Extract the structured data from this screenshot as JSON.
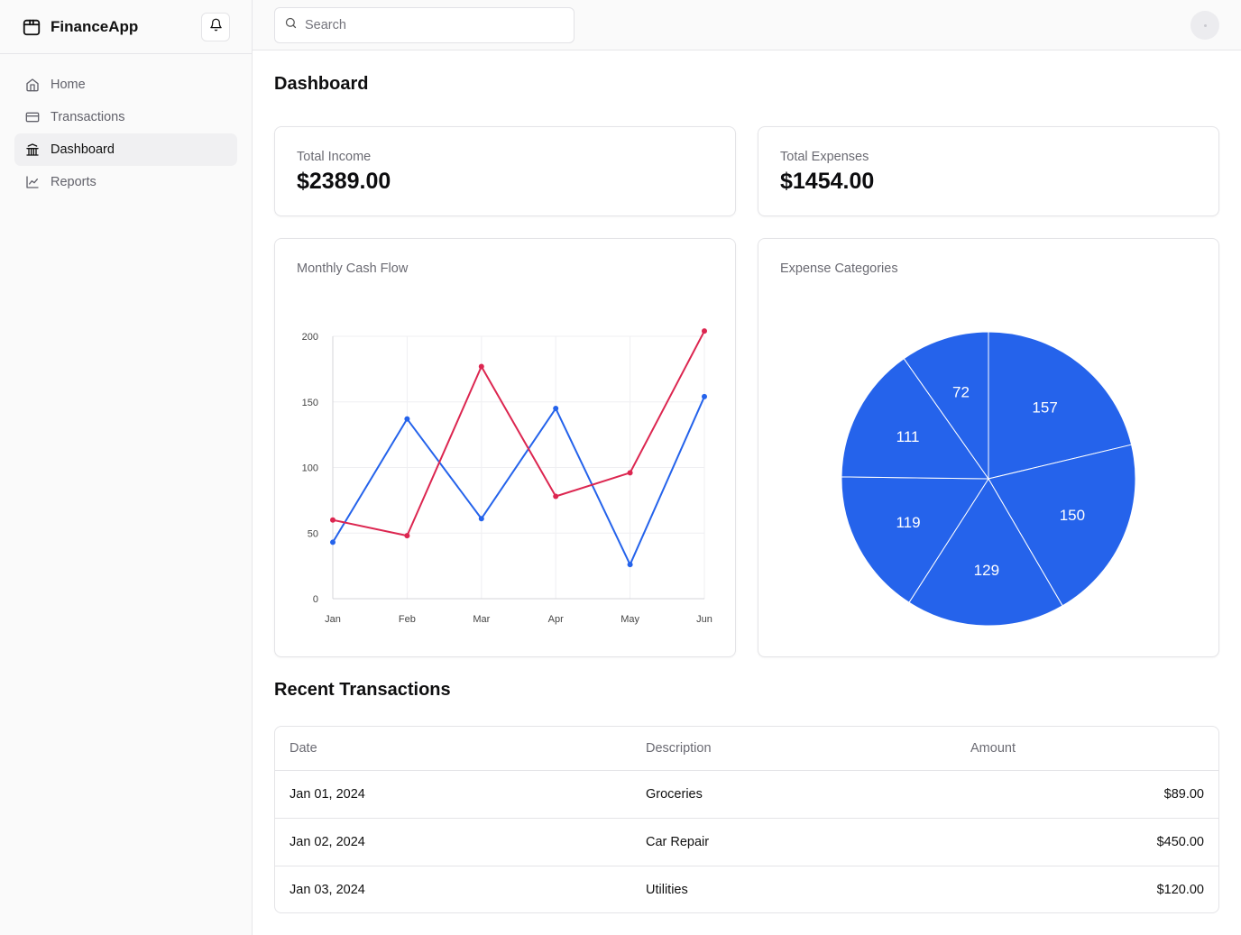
{
  "app": {
    "name": "FinanceApp"
  },
  "sidebar": {
    "items": [
      {
        "label": "Home",
        "icon": "home-icon",
        "active": false
      },
      {
        "label": "Transactions",
        "icon": "credit-card-icon",
        "active": false
      },
      {
        "label": "Dashboard",
        "icon": "bank-icon",
        "active": true
      },
      {
        "label": "Reports",
        "icon": "line-chart-icon",
        "active": false
      }
    ]
  },
  "topbar": {
    "search_placeholder": "Search"
  },
  "page": {
    "title": "Dashboard"
  },
  "stats": {
    "income": {
      "label": "Total Income",
      "value": "$2389.00"
    },
    "expenses": {
      "label": "Total Expenses",
      "value": "$1454.00"
    }
  },
  "cashflow": {
    "title": "Monthly Cash Flow"
  },
  "expense_categories": {
    "title": "Expense Categories"
  },
  "chart_data": [
    {
      "type": "line",
      "title": "Monthly Cash Flow",
      "categories": [
        "Jan",
        "Feb",
        "Mar",
        "Apr",
        "May",
        "Jun"
      ],
      "ylim": [
        0,
        200
      ],
      "yticks": [
        0,
        50,
        100,
        150,
        200
      ],
      "grid": true,
      "series": [
        {
          "values": [
            43,
            137,
            61,
            145,
            26,
            154
          ],
          "color": "#2563eb"
        },
        {
          "values": [
            60,
            48,
            177,
            78,
            96,
            204
          ],
          "color": "#dc2650"
        }
      ]
    },
    {
      "type": "pie",
      "title": "Expense Categories",
      "values": [
        157,
        150,
        129,
        119,
        111,
        72
      ],
      "color": "#2563eb"
    }
  ],
  "transactions": {
    "title": "Recent Transactions",
    "headers": {
      "date": "Date",
      "description": "Description",
      "amount": "Amount"
    },
    "rows": [
      {
        "date": "Jan 01, 2024",
        "description": "Groceries",
        "amount": "$89.00"
      },
      {
        "date": "Jan 02, 2024",
        "description": "Car Repair",
        "amount": "$450.00"
      },
      {
        "date": "Jan 03, 2024",
        "description": "Utilities",
        "amount": "$120.00"
      }
    ]
  }
}
